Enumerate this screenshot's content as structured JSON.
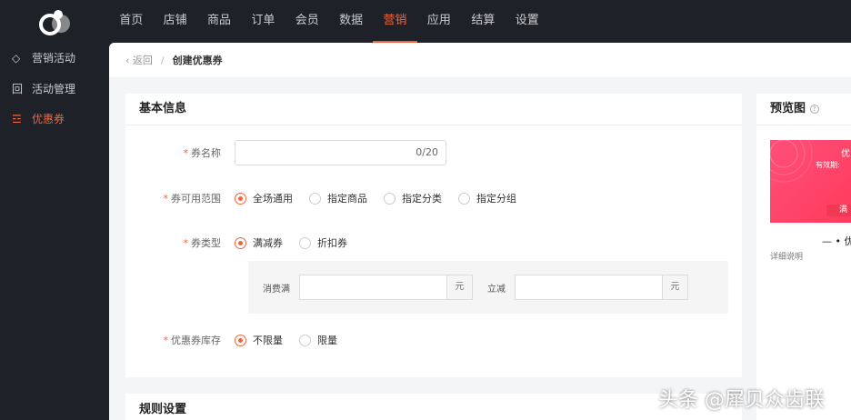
{
  "nav": {
    "items": [
      "首页",
      "店铺",
      "商品",
      "订单",
      "会员",
      "数据",
      "营销",
      "应用",
      "结算",
      "设置"
    ],
    "active": 6
  },
  "sidebar": {
    "items": [
      {
        "icon": "tag-icon",
        "glyph": "⌂",
        "label": "营销活动"
      },
      {
        "icon": "activity-icon",
        "glyph": "回",
        "label": "活动管理"
      },
      {
        "icon": "coupon-icon",
        "glyph": "☲",
        "label": "优惠券"
      }
    ]
  },
  "breadcrumb": {
    "back": "返回",
    "sep": "/",
    "current": "创建优惠券"
  },
  "basic": {
    "title": "基本信息",
    "name": {
      "label": "券名称",
      "counter": "0/20"
    },
    "scope": {
      "label": "券可用范围",
      "options": [
        "全场通用",
        "指定商品",
        "指定分类",
        "指定分组"
      ]
    },
    "type": {
      "label": "券类型",
      "options": [
        "满减券",
        "折扣券"
      ],
      "spend_label": "消费满",
      "unit": "元",
      "reduce_label": "立减"
    },
    "stock": {
      "label": "优惠券库存",
      "options": [
        "不限量",
        "限量"
      ]
    }
  },
  "rules": {
    "title": "规则设置"
  },
  "preview": {
    "title": "预览图",
    "help": "?",
    "coupon_title": "优",
    "coupon_sub": "有效期:",
    "coupon_btn": "满",
    "name_line": "— • 优",
    "detail": "详细说明"
  },
  "watermark": "头条 @犀贝众齿联",
  "colors": {
    "accent": "#f0643c",
    "topbar": "#1f2128"
  }
}
